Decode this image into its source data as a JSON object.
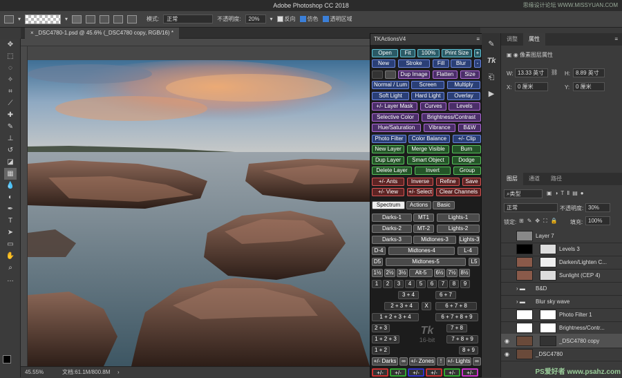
{
  "app": {
    "title": "Adobe Photoshop CC 2018"
  },
  "options_bar": {
    "mode_label": "模式:",
    "mode_value": "正常",
    "opacity_label": "不透明度:",
    "opacity_value": "20%",
    "reverse": "反向",
    "dither": "仿色",
    "transparency": "透明区域"
  },
  "document": {
    "tab_title": "_DSC4780-1.psd @ 45.6% (_DSC4780 copy, RGB/16) *"
  },
  "status": {
    "zoom": "45.55%",
    "doc_size": "文档:61.1M/800.8M"
  },
  "tk_panel": {
    "title": "TKActionsV4",
    "row1": [
      "Open",
      "Fit",
      "100%",
      "Print Size",
      "+"
    ],
    "row2": [
      "New",
      "Stroke",
      "Fill",
      "Blur",
      "-"
    ],
    "row3": [
      "Dup Image",
      "Flatten",
      "Size"
    ],
    "row4": [
      "Normal / Lum",
      "Screen",
      "Multiply"
    ],
    "row5": [
      "Soft Light",
      "Hard Light",
      "Overlay"
    ],
    "row6": [
      "+/- Layer Mask",
      "Curves",
      "Levels"
    ],
    "row7": [
      "Selective Color",
      "Brightness/Contrast"
    ],
    "row8": [
      "Hue/Saturation",
      "Vibrance",
      "B&W"
    ],
    "row9": [
      "Photo Filter",
      "Color Balance",
      "+/- Clip"
    ],
    "row10": [
      "New Layer",
      "Merge Visible",
      "Burn"
    ],
    "row11": [
      "Dup Layer",
      "Smart Object",
      "Dodge"
    ],
    "row12": [
      "Delete Layer",
      "Invert",
      "Group"
    ],
    "row13": [
      "+/- Ants",
      "Inverse",
      "Refine",
      "Save"
    ],
    "row14": [
      "+/- View",
      "+/- Select",
      "Clear Channels"
    ],
    "tabs": [
      "Spectrum",
      "Actions",
      "Basic"
    ],
    "spectrum": [
      "Darks-1",
      "MT1",
      "Lights-1",
      "Darks-2",
      "MT-2",
      "Lights-2",
      "Darks-3",
      "Midtones-3",
      "Lights-3",
      "D-4",
      "Midtones-4",
      "L-4",
      "D5",
      "Midtones-5",
      "L5"
    ],
    "zones_row": [
      "1½",
      "2½",
      "3½",
      "Alt-5",
      "6½",
      "7½",
      "8½"
    ],
    "zones": [
      "1",
      "2",
      "3",
      "4",
      "5",
      "6",
      "7",
      "8",
      "9"
    ],
    "combos": [
      "3 + 4",
      "6 + 7",
      "2 + 3 + 4",
      "X",
      "6 + 7 + 8",
      "1 + 2 + 3 + 4",
      "6 + 7 + 8 + 9",
      "2 + 3",
      "7 + 8",
      "1 + 2 + 3",
      "7 + 8 + 9",
      "1 + 2",
      "8 + 9"
    ],
    "logo": "16-bit",
    "bottom": [
      "+/- Darks",
      "∞",
      "+/- Zones",
      "!",
      "+/- Lights",
      "∞"
    ],
    "color_row": [
      "+/-",
      "+/-",
      "+/-",
      "+/-",
      "+/-",
      "+/-"
    ]
  },
  "properties": {
    "tabs": [
      "调整",
      "属性"
    ],
    "header": "像素图层属性",
    "w_label": "W:",
    "w_value": "13.33 英寸",
    "h_label": "H:",
    "h_value": "8.89 英寸",
    "x_label": "X:",
    "x_value": "0 厘米",
    "y_label": "Y:",
    "y_value": "0 厘米"
  },
  "layers_panel": {
    "tabs": [
      "图层",
      "通道",
      "路径"
    ],
    "filter": "类型",
    "blend": "正常",
    "opacity_label": "不透明度:",
    "opacity": "30%",
    "lock_label": "锁定:",
    "fill_label": "填充:",
    "fill": "100%",
    "layers": [
      {
        "name": "Layer 7"
      },
      {
        "name": "Levels 3"
      },
      {
        "name": "Darken/Lighten C..."
      },
      {
        "name": "Sunlight (CEP 4)"
      },
      {
        "name": "B&D"
      },
      {
        "name": "Blur sky wave"
      },
      {
        "name": "Photo Filter 1"
      },
      {
        "name": "Brightness/Contr..."
      },
      {
        "name": "_DSC4780 copy"
      },
      {
        "name": "_DSC4780"
      }
    ]
  },
  "watermark": {
    "top": "思缘设计论坛 WWW.MISSYUAN.COM",
    "bottom": "PS爱好者 www.psahz.com"
  }
}
